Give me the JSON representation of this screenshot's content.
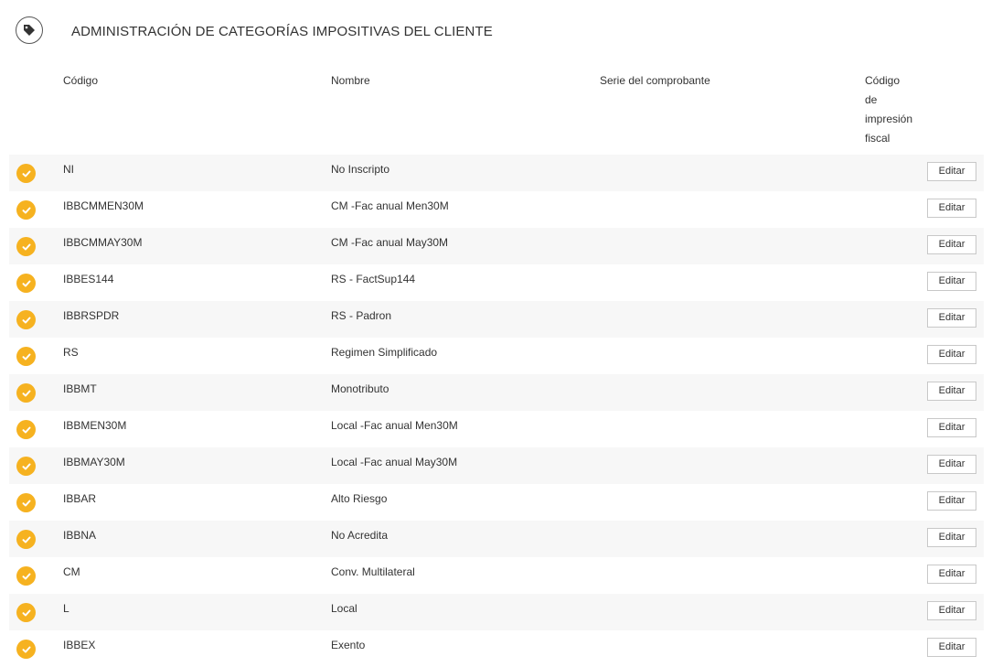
{
  "header": {
    "icon": "tag-icon",
    "title": "ADMINISTRACIÓN DE CATEGORÍAS IMPOSITIVAS DEL CLIENTE"
  },
  "columns": {
    "codigo": "Código",
    "nombre": "Nombre",
    "serie": "Serie del comprobante",
    "impresion": [
      "Código",
      "de",
      "impresión",
      "fiscal"
    ]
  },
  "colors": {
    "check": "#f6b220",
    "stripe": "#f7f7f7"
  },
  "edit_label": "Editar",
  "rows": [
    {
      "code": "NI",
      "name": "No Inscripto"
    },
    {
      "code": "IBBCMMEN30M",
      "name": "CM -Fac anual Men30M"
    },
    {
      "code": "IBBCMMAY30M",
      "name": "CM -Fac anual May30M"
    },
    {
      "code": "IBBES144",
      "name": "RS - FactSup144"
    },
    {
      "code": "IBBRSPDR",
      "name": "RS - Padron"
    },
    {
      "code": "RS",
      "name": "Regimen Simplificado"
    },
    {
      "code": "IBBMT",
      "name": "Monotributo"
    },
    {
      "code": "IBBMEN30M",
      "name": "Local -Fac anual Men30M"
    },
    {
      "code": "IBBMAY30M",
      "name": "Local -Fac anual May30M"
    },
    {
      "code": "IBBAR",
      "name": "Alto Riesgo"
    },
    {
      "code": "IBBNA",
      "name": "No Acredita"
    },
    {
      "code": "CM",
      "name": "Conv. Multilateral"
    },
    {
      "code": "L",
      "name": "Local"
    },
    {
      "code": "IBBEX",
      "name": "Exento"
    }
  ]
}
